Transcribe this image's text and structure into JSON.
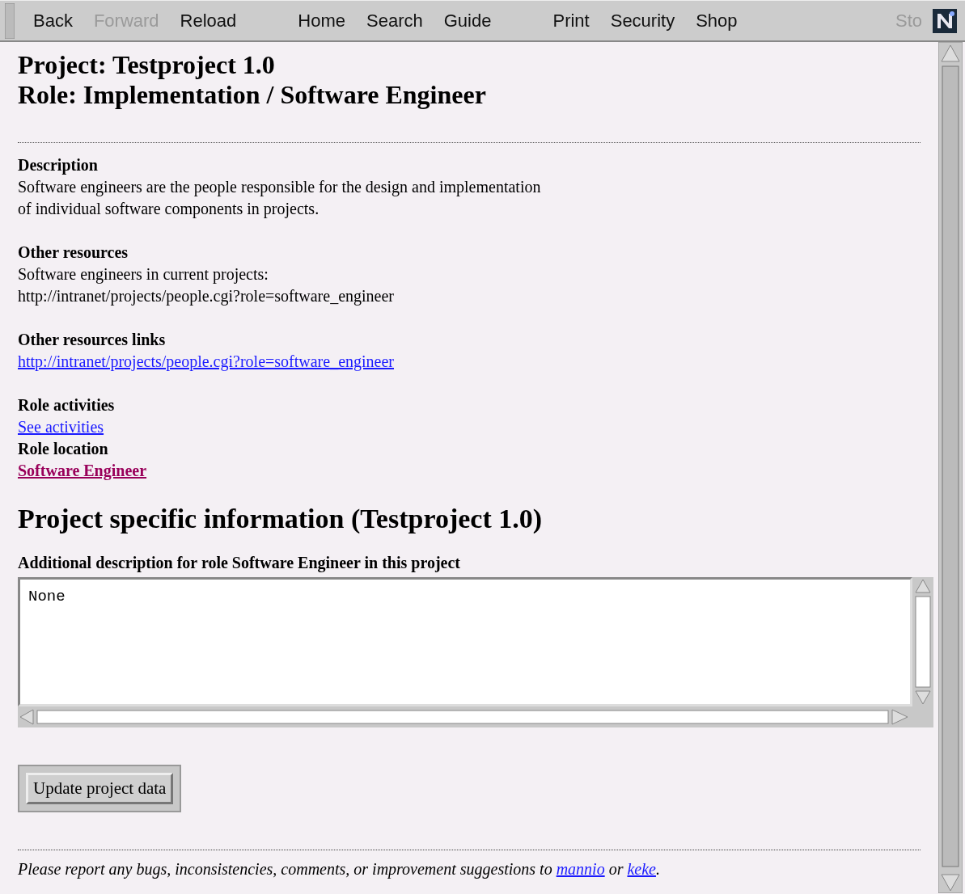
{
  "toolbar": {
    "groups": [
      [
        {
          "label": "Back",
          "disabled": false
        },
        {
          "label": "Forward",
          "disabled": true
        },
        {
          "label": "Reload",
          "disabled": false
        }
      ],
      [
        {
          "label": "Home",
          "disabled": false
        },
        {
          "label": "Search",
          "disabled": false
        },
        {
          "label": "Guide",
          "disabled": false
        }
      ],
      [
        {
          "label": "Print",
          "disabled": false
        },
        {
          "label": "Security",
          "disabled": false
        },
        {
          "label": "Shop",
          "disabled": false
        }
      ],
      [
        {
          "label": "Sto",
          "disabled": true
        }
      ]
    ]
  },
  "page": {
    "title_lines": [
      "Project: Testproject 1.0",
      "Role: Implementation / Software Engineer"
    ],
    "blocks": [
      [
        {
          "kind": "heading",
          "text": "Description"
        },
        {
          "kind": "text",
          "text": "Software engineers are the people responsible for the design and implementation"
        },
        {
          "kind": "text",
          "text": "of individual software components in projects."
        }
      ],
      [
        {
          "kind": "heading",
          "text": "Other resources"
        },
        {
          "kind": "text",
          "text": "Software engineers in current projects:"
        },
        {
          "kind": "text",
          "text": "http://intranet/projects/people.cgi?role=software_engineer"
        }
      ],
      [
        {
          "kind": "heading",
          "text": "Other resources links"
        },
        {
          "kind": "link",
          "text": "http://intranet/projects/people.cgi?role=software_engineer",
          "visited": false
        }
      ],
      [
        {
          "kind": "heading",
          "text": "Role activities"
        },
        {
          "kind": "link",
          "text": "See activities",
          "visited": false
        },
        {
          "kind": "heading",
          "text": "Role location"
        },
        {
          "kind": "link",
          "text": "Software Engineer",
          "visited": true
        }
      ]
    ],
    "section_title": "Project specific information (Testproject 1.0)",
    "field_label": "Additional description for role Software Engineer in this project",
    "field_value": "None",
    "button": "Update project data",
    "footer": {
      "text": "Please report any bugs, inconsistencies, comments, or improvement suggestions to",
      "links": [
        {
          "text": "mannio",
          "sep": "or"
        },
        {
          "text": "keke",
          "sep": "."
        }
      ]
    }
  }
}
